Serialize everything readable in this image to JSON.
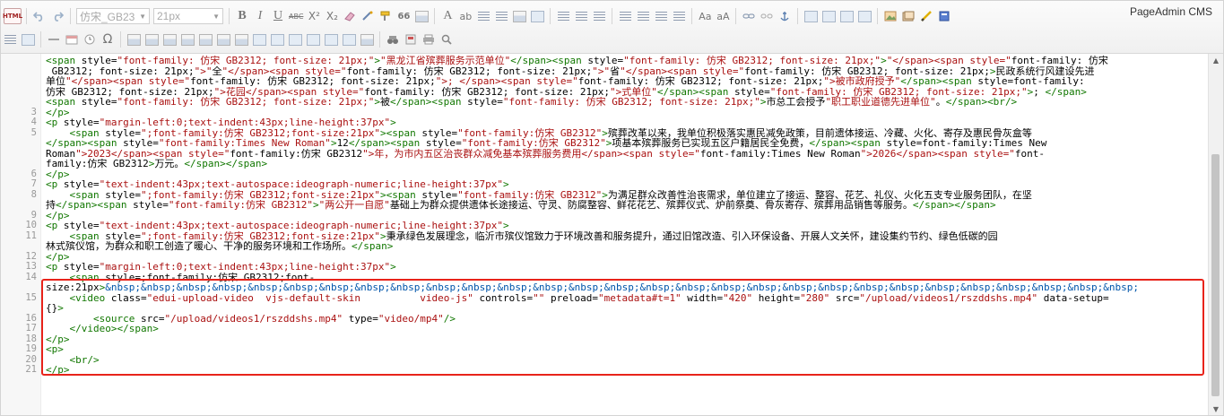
{
  "toolbar": {
    "html_label": "HTML",
    "font_family_value": "仿宋_GB23",
    "font_size_value": "21px",
    "quote_label": "66",
    "bold_label": "B",
    "italic_label": "I",
    "underline_label": "U",
    "strike_label": "ABC",
    "sup_label": "X²",
    "sub_label": "X₂",
    "font_color_label": "A",
    "bg_color_label": "ab",
    "omega_label": "Ω"
  },
  "brand": "PageAdmin CMS",
  "code_lines": [
    {
      "n": "",
      "text": "<span style=\"font-family: 仿宋_GB2312; font-size: 21px;\">\"黑龙江省殡葬服务示范单位\"</span><span style=\"font-family: 仿宋_GB2312; font-size: 21px;\">\"</span><span style=\"font-family: 仿宋"
    },
    {
      "n": "",
      "text": "_GB2312; font-size: 21px;\">\"全\"</span><span style=\"font-family: 仿宋_GB2312; font-size: 21px;\">\"省\"</span><span style=\"font-family: 仿宋_GB2312; font-size: 21px;\">民政系统行风建设先进"
    },
    {
      "n": "",
      "text": "单位\"</span><span style=\"font-family: 仿宋_GB2312; font-size: 21px;\">; </span><span style=\"font-family: 仿宋_GB2312; font-size: 21px;\">被市政府授予\"</span><span style=\"font-family:"
    },
    {
      "n": "",
      "text": "仿宋_GB2312; font-size: 21px;\">花园</span><span style=\"font-family: 仿宋_GB2312; font-size: 21px;\">式单位\"</span><span style=\"font-family: 仿宋_GB2312; font-size: 21px;\">; </span>"
    },
    {
      "n": "",
      "text": "<span style=\"font-family: 仿宋_GB2312; font-size: 21px;\">被</span><span style=\"font-family: 仿宋_GB2312; font-size: 21px;\">市总工会授予\"职工职业道德先进单位\"。</span><br/>"
    },
    {
      "n": "3",
      "text": "</p>"
    },
    {
      "n": "4",
      "text": "<p style=\"margin-left:0;text-indent:43px;line-height:37px\">"
    },
    {
      "n": "5",
      "text": "    <span style=\";font-family:仿宋_GB2312;font-size:21px\"><span style=\"font-family:仿宋_GB2312\">殡葬改革以来，我单位积极落实惠民减免政策，目前遗体接运、冷藏、火化、寄存及惠民骨灰盒等"
    },
    {
      "n": "",
      "text": "</span><span style=\"font-family:Times New Roman\">12</span><span style=\"font-family:仿宋_GB2312\">项基本殡葬服务已实现五区户籍居民全免费，</span><span style=\"font-family:Times New"
    },
    {
      "n": "",
      "text": "Roman\">2023</span><span style=\"font-family:仿宋_GB2312\">年，为市内五区治丧群众减免基本殡葬服务费用</span><span style=\"font-family:Times New Roman\">2026</span><span style=\"font-"
    },
    {
      "n": "",
      "text": "family:仿宋_GB2312\">万元。</span></span>"
    },
    {
      "n": "6",
      "text": "</p>"
    },
    {
      "n": "7",
      "text": "<p style=\"text-indent:43px;text-autospace:ideograph-numeric;line-height:37px\">"
    },
    {
      "n": "8",
      "text": "    <span style=\";font-family:仿宋_GB2312;font-size:21px\"><span style=\"font-family:仿宋_GB2312\">为满足群众改善性治丧需求，单位建立了接运、整容、花艺、礼仪、火化五支专业服务团队，在坚"
    },
    {
      "n": "",
      "text": "持</span><span style=\"font-family:仿宋_GB2312\">\"两公开一自愿\"基础上为群众提供遗体长途接运、守灵、防腐整容、鲜花花艺、殡葬仪式、炉前祭奠、骨灰寄存、殡葬用品销售等服务。</span></span>"
    },
    {
      "n": "9",
      "text": "</p>"
    },
    {
      "n": "10",
      "text": "<p style=\"text-indent:43px;text-autospace:ideograph-numeric;line-height:37px\">"
    },
    {
      "n": "11",
      "text": "    <span style=\";font-family:仿宋_GB2312;font-size:21px\">秉承绿色发展理念，临沂市殡仪馆致力于环境改善和服务提升，通过旧馆改造、引入环保设备、开展人文关怀，建设集约节约、绿色低碳的园"
    },
    {
      "n": "",
      "text": "林式殡仪馆，为群众和职工创造了暖心、干净的服务环境和工作场所。</span>"
    },
    {
      "n": "12",
      "text": "</p>"
    },
    {
      "n": "13",
      "text": "<p style=\"margin-left:0;text-indent:43px;line-height:37px\">"
    },
    {
      "n": "14",
      "text": "    <span style=\";font-family:仿宋_GB2312;font-"
    },
    {
      "n": "",
      "text": "size:21px\">&nbsp;&nbsp;&nbsp;&nbsp;&nbsp;&nbsp;&nbsp;&nbsp;&nbsp;&nbsp;&nbsp;&nbsp;&nbsp;&nbsp;&nbsp;&nbsp;&nbsp;&nbsp;&nbsp;&nbsp;&nbsp;&nbsp;&nbsp;&nbsp;&nbsp;&nbsp;&nbsp;&nbsp;&nbsp;"
    },
    {
      "n": "15",
      "text": "    <video class=\"edui-upload-video  vjs-default-skin          video-js\" controls=\"\" preload=\"metadata#t=1\" width=\"420\" height=\"280\" src=\"/upload/videos1/rszddshs.mp4\" data-setup=\""
    },
    {
      "n": "",
      "text": "{}\">"
    },
    {
      "n": "16",
      "text": "        <source src=\"/upload/videos1/rszddshs.mp4\" type=\"video/mp4\"/>"
    },
    {
      "n": "17",
      "text": "    </video></span>"
    },
    {
      "n": "18",
      "text": "</p>"
    },
    {
      "n": "19",
      "text": "<p>"
    },
    {
      "n": "20",
      "text": "    <br/>"
    },
    {
      "n": "21",
      "text": "</p>"
    }
  ]
}
